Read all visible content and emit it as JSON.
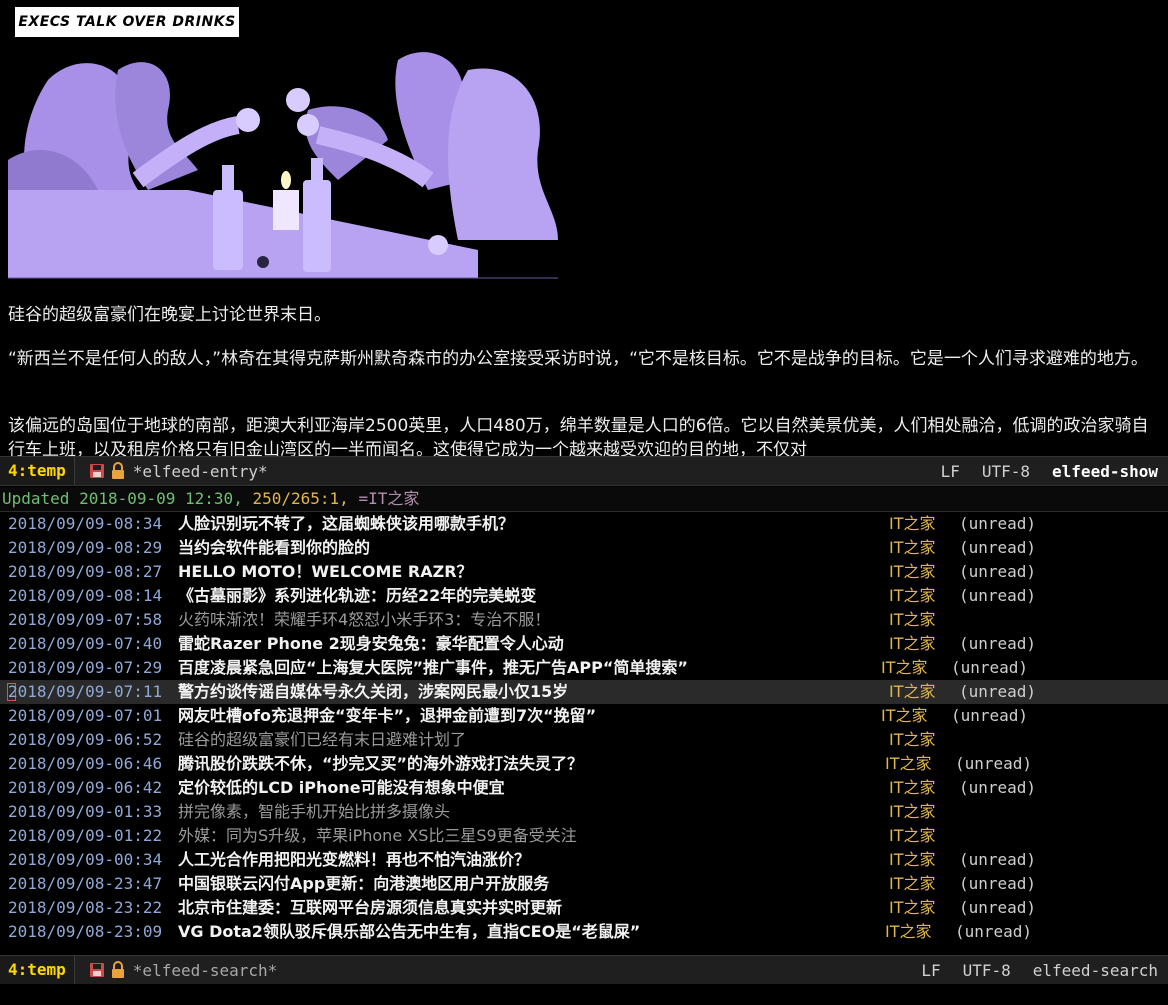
{
  "entry": {
    "comic_title": "EXECS TALK OVER DRINKS",
    "paragraphs": [
      "硅谷的超级富豪们在晚宴上讨论世界末日。",
      "“新西兰不是任何人的敌人，”林奇在其得克萨斯州默奇森市的办公室接受采访时说，“它不是核目标。它不是战争的目标。它是一个人们寻求避难的地方。",
      "该偏远的岛国位于地球的南部，距澳大利亚海岸2500英里，人口480万，绵羊数量是人口的6倍。它以自然美景优美，人们相处融洽，低调的政治家骑自行车上班，以及租房价格只有旧金山湾区的一半而闻名。这使得它成为一个越来越受欢迎的目的地，不仅对"
    ]
  },
  "modeline_top": {
    "window": "4:temp",
    "buffer": "*elfeed-entry*",
    "eol": "LF",
    "encoding": "UTF-8",
    "mode": "elfeed-show"
  },
  "header": {
    "updated": "Updated 2018-09-09 12:30,",
    "count": "250/265:1,",
    "filter": "=IT之家"
  },
  "entries": [
    {
      "date": "2018/09/09-08:34",
      "title": "人脸识别玩不转了，这届蜘蛛侠该用哪款手机？",
      "feed": "IT之家",
      "tag": "(unread)"
    },
    {
      "date": "2018/09/09-08:29",
      "title": "当约会软件能看到你的脸的",
      "feed": "IT之家",
      "tag": "(unread)"
    },
    {
      "date": "2018/09/09-08:27",
      "title": "HELLO MOTO！WELCOME RAZR？",
      "feed": "IT之家",
      "tag": "(unread)"
    },
    {
      "date": "2018/09/09-08:14",
      "title": "《古墓丽影》系列进化轨迹：历经22年的完美蜕变",
      "feed": "IT之家",
      "tag": "(unread)"
    },
    {
      "date": "2018/09/09-07:58",
      "title": "火药味渐浓！荣耀手环4怒怼小米手环3：专治不服！",
      "feed": "IT之家",
      "tag": ""
    },
    {
      "date": "2018/09/09-07:40",
      "title": "雷蛇Razer Phone 2现身安兔兔：豪华配置令人心动",
      "feed": "IT之家",
      "tag": "(unread)"
    },
    {
      "date": "2018/09/09-07:29",
      "title": "百度凌晨紧急回应“上海复大医院”推广事件，推无广告APP“简单搜索”",
      "feed": "IT之家",
      "tag": "(unread)"
    },
    {
      "date": "2018/09/09-07:11",
      "title": "警方约谈传谣自媒体号永久关闭，涉案网民最小仅15岁",
      "feed": "IT之家",
      "tag": "(unread)"
    },
    {
      "date": "2018/09/09-07:01",
      "title": "网友吐槽ofo充退押金“变年卡”，退押金前遭到7次“挽留”",
      "feed": "IT之家",
      "tag": "(unread)"
    },
    {
      "date": "2018/09/09-06:52",
      "title": "硅谷的超级富豪们已经有末日避难计划了",
      "feed": "IT之家",
      "tag": ""
    },
    {
      "date": "2018/09/09-06:46",
      "title": "腾讯股价跌跌不休，“抄完又买”的海外游戏打法失灵了？",
      "feed": "IT之家",
      "tag": "(unread)"
    },
    {
      "date": "2018/09/09-06:42",
      "title": "定价较低的LCD iPhone可能没有想象中便宜",
      "feed": "IT之家",
      "tag": "(unread)"
    },
    {
      "date": "2018/09/09-01:33",
      "title": "拼完像素，智能手机开始比拼多摄像头",
      "feed": "IT之家",
      "tag": ""
    },
    {
      "date": "2018/09/09-01:22",
      "title": "外媒：同为S升级，苹果iPhone XS比三星S9更备受关注",
      "feed": "IT之家",
      "tag": ""
    },
    {
      "date": "2018/09/09-00:34",
      "title": "人工光合作用把阳光变燃料！再也不怕汽油涨价？",
      "feed": "IT之家",
      "tag": "(unread)"
    },
    {
      "date": "2018/09/08-23:47",
      "title": "中国银联云闪付App更新：向港澳地区用户开放服务",
      "feed": "IT之家",
      "tag": "(unread)"
    },
    {
      "date": "2018/09/08-23:22",
      "title": "北京市住建委：互联网平台房源须信息真实并实时更新",
      "feed": "IT之家",
      "tag": "(unread)"
    },
    {
      "date": "2018/09/08-23:09",
      "title": "VG Dota2领队驳斥俱乐部公告无中生有，直指CEO是“老鼠屎”",
      "feed": "IT之家",
      "tag": "(unread)"
    }
  ],
  "modeline_bottom": {
    "window": "4:temp",
    "buffer": "*elfeed-search*",
    "eol": "LF",
    "encoding": "UTF-8",
    "mode": "elfeed-search"
  },
  "colors": {
    "background": "#000000",
    "date": "#8fa8d8",
    "feed": "#e0b64a",
    "updated": "#6fbf73",
    "window_number": "#ffd700",
    "save_icon": "#d04848",
    "lock_icon": "#e8a33d",
    "comic_fill": "#b8a2f2"
  }
}
